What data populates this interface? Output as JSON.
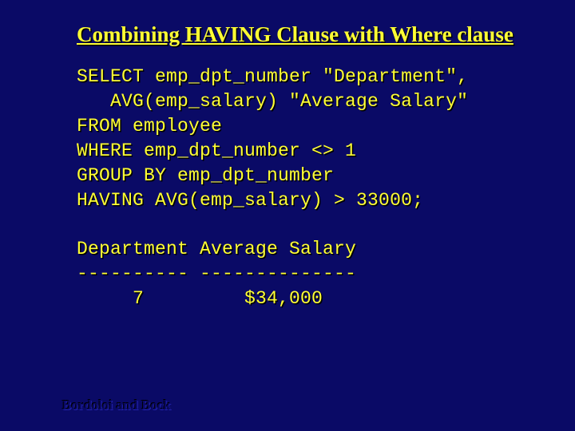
{
  "title": "Combining HAVING Clause with Where clause",
  "sql": {
    "l1": "SELECT emp_dpt_number \"Department\",",
    "l2": "   AVG(emp_salary) \"Average Salary\"",
    "l3": "FROM employee",
    "l4": "WHERE emp_dpt_number <> 1",
    "l5": "GROUP BY emp_dpt_number",
    "l6": "HAVING AVG(emp_salary) > 33000;"
  },
  "result": {
    "h1": "Department Average Salary",
    "h2": "---------- --------------",
    "r1": "     7         $34,000"
  },
  "footer": "Bordoloi and Bock"
}
